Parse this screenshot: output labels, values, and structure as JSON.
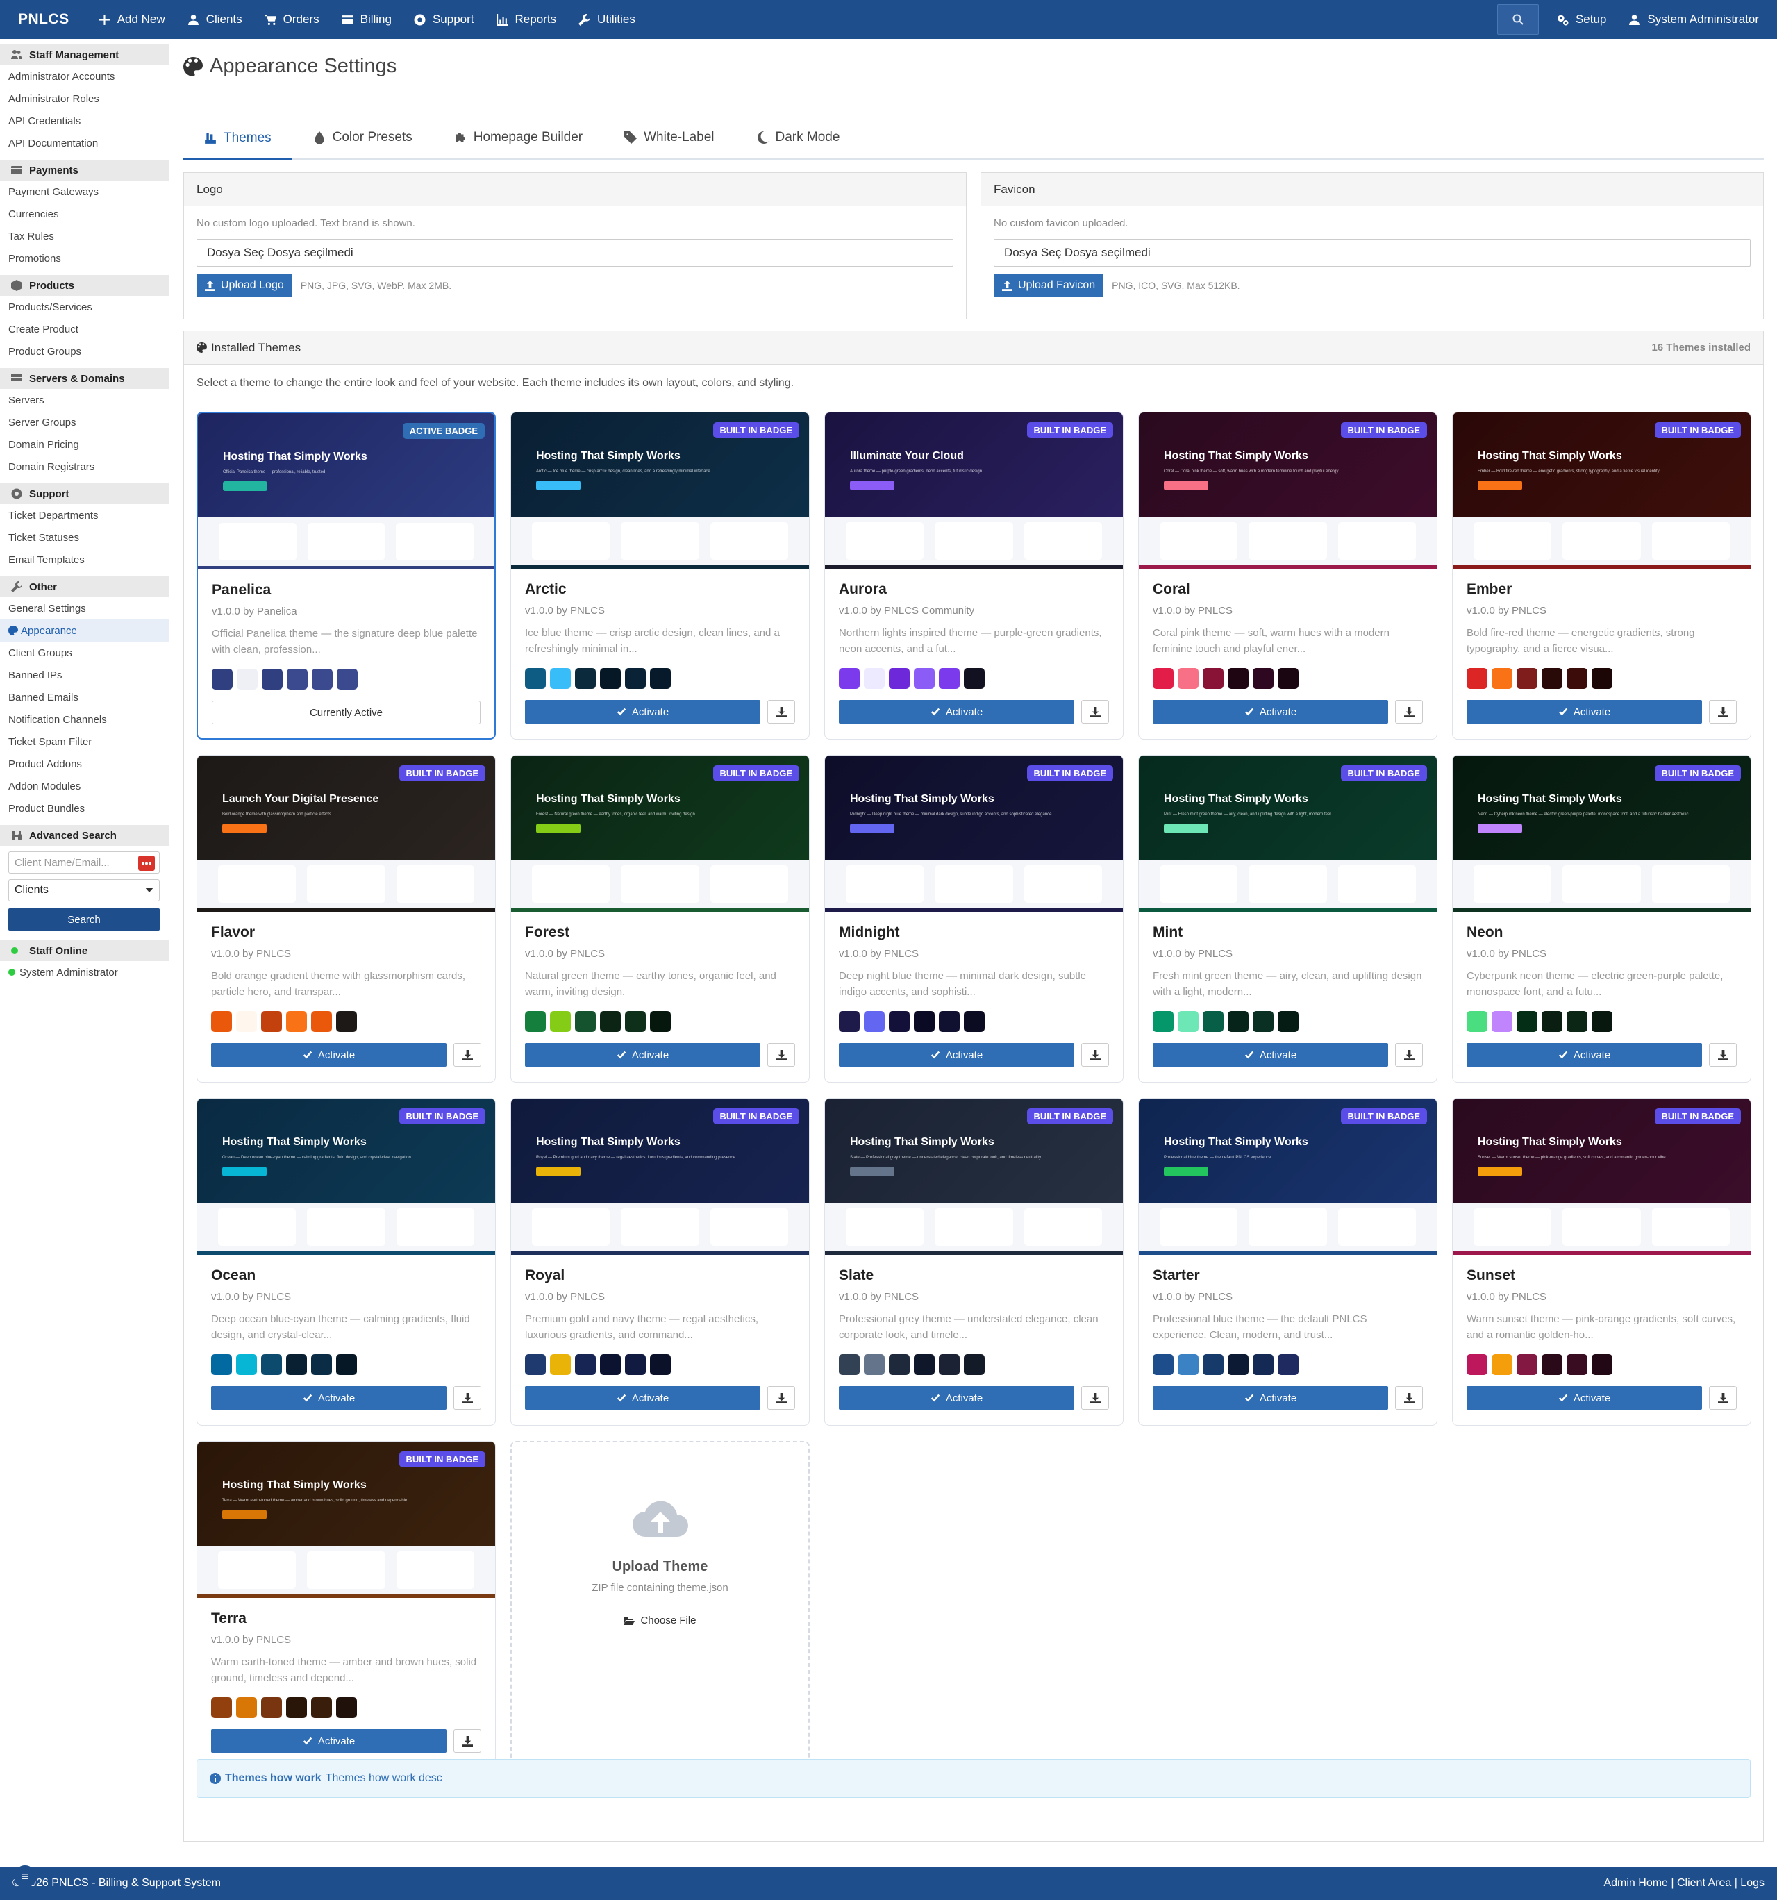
{
  "topbar": {
    "brand": "PNLCS",
    "nav": [
      "Add New",
      "Clients",
      "Orders",
      "Billing",
      "Support",
      "Reports",
      "Utilities"
    ],
    "setup": "Setup",
    "user": "System Administrator"
  },
  "sidebar": {
    "sections": [
      {
        "title": "Staff Management",
        "items": [
          "Administrator Accounts",
          "Administrator Roles",
          "API Credentials",
          "API Documentation"
        ]
      },
      {
        "title": "Payments",
        "items": [
          "Payment Gateways",
          "Currencies",
          "Tax Rules",
          "Promotions"
        ]
      },
      {
        "title": "Products",
        "items": [
          "Products/Services",
          "Create Product",
          "Product Groups"
        ]
      },
      {
        "title": "Servers & Domains",
        "items": [
          "Servers",
          "Server Groups",
          "Domain Pricing",
          "Domain Registrars"
        ]
      },
      {
        "title": "Support",
        "items": [
          "Ticket Departments",
          "Ticket Statuses",
          "Email Templates"
        ]
      },
      {
        "title": "Other",
        "items": [
          "General Settings",
          "Appearance",
          "Client Groups",
          "Banned IPs",
          "Banned Emails",
          "Notification Channels",
          "Ticket Spam Filter",
          "Product Addons",
          "Addon Modules",
          "Product Bundles"
        ]
      }
    ],
    "advanced_search": {
      "title": "Advanced Search",
      "placeholder": "Client Name/Email...",
      "dots": "•••",
      "select_value": "Clients",
      "button": "Search"
    },
    "staff_online": {
      "title": "Staff Online",
      "user": "System Administrator"
    }
  },
  "page": {
    "title": "Appearance Settings",
    "tabs": [
      "Themes",
      "Color Presets",
      "Homepage Builder",
      "White-Label",
      "Dark Mode"
    ]
  },
  "logo_panel": {
    "title": "Logo",
    "note": "No custom logo uploaded. Text brand is shown.",
    "file_text": "Dosya Seç Dosya seçilmedi",
    "button": "Upload Logo",
    "hint": "PNG, JPG, SVG, WebP. Max 2MB."
  },
  "favicon_panel": {
    "title": "Favicon",
    "note": "No custom favicon uploaded.",
    "file_text": "Dosya Seç Dosya seçilmedi",
    "button": "Upload Favicon",
    "hint": "PNG, ICO, SVG. Max 512KB."
  },
  "themes_panel": {
    "title": "Installed Themes",
    "count": "16 Themes installed",
    "intro": "Select a theme to change the entire look and feel of your website. Each theme includes its own layout, colors, and styling.",
    "activate_label": "Activate",
    "current_label": "Currently Active",
    "active_badge": "ACTIVE BADGE",
    "builtin_badge": "BUILT IN BADGE",
    "themes": [
      {
        "name": "Panelica",
        "version": "v1.0.0 by Panelica",
        "desc": "Official Panelica theme — the signature deep blue palette with clean, profession...",
        "preview_title": "Hosting That Simply Works",
        "preview_sub": "Official Panelica theme — professional, reliable, trusted",
        "colors": [
          "#2f3f7f",
          "#eef0f6",
          "#2f3f7f",
          "#3b4a8f",
          "#3b4a8f",
          "#3b4a8f"
        ],
        "grad": [
          "#1e2560",
          "#2c3b80"
        ],
        "btn": "#22b5a0",
        "line": "#2f3f7f",
        "active": true
      },
      {
        "name": "Arctic",
        "version": "v1.0.0 by PNLCS",
        "desc": "Ice blue theme — crisp arctic design, clean lines, and a refreshingly minimal in...",
        "preview_title": "Hosting That Simply Works",
        "preview_sub": "Arctic — Ice blue theme — crisp arctic design, clean lines, and a refreshingly minimal interface.",
        "colors": [
          "#0e5b84",
          "#38bdf8",
          "#0b2a3c",
          "#061826",
          "#0a2236",
          "#071a2b"
        ],
        "grad": [
          "#0a1f33",
          "#0d2f48"
        ],
        "btn": "#38bdf8",
        "line": "#0b2a3c",
        "active": false
      },
      {
        "name": "Aurora",
        "version": "v1.0.0 by PNLCS Community",
        "desc": "Northern lights inspired theme — purple-green gradients, neon accents, and a fut...",
        "preview_title": "Illuminate Your Cloud",
        "preview_sub": "Aurora theme — purple-green gradients, neon accents, futuristic design",
        "colors": [
          "#7c3aed",
          "#ede9fe",
          "#6d28d9",
          "#8b5cf6",
          "#7c3aed",
          "#111122"
        ],
        "grad": [
          "#1a1340",
          "#2a2060"
        ],
        "btn": "#8b5cf6",
        "line": "#1b1b2b",
        "active": false
      },
      {
        "name": "Coral",
        "version": "v1.0.0 by PNLCS",
        "desc": "Coral pink theme — soft, warm hues with a modern feminine touch and playful ener...",
        "preview_title": "Hosting That Simply Works",
        "preview_sub": "Coral — Coral pink theme — soft, warm hues with a modern feminine touch and playful energy.",
        "colors": [
          "#e11d48",
          "#f77085",
          "#881337",
          "#1f0512",
          "#2e0820",
          "#1a0610"
        ],
        "grad": [
          "#2a0a1e",
          "#3d0c2a"
        ],
        "btn": "#f77085",
        "line": "#9c1a4a",
        "active": false
      },
      {
        "name": "Ember",
        "version": "v1.0.0 by PNLCS",
        "desc": "Bold fire-red theme — energetic gradients, strong typography, and a fierce visua...",
        "preview_title": "Hosting That Simply Works",
        "preview_sub": "Ember — Bold fire-red theme — energetic gradients, strong typography, and a fierce visual identity.",
        "colors": [
          "#dc2626",
          "#f97316",
          "#7f1d1d",
          "#2a0a08",
          "#3b0c0a",
          "#1c0606"
        ],
        "grad": [
          "#2a0808",
          "#3d0f0a"
        ],
        "btn": "#f97316",
        "line": "#8b1a1a",
        "active": false
      },
      {
        "name": "Flavor",
        "version": "v1.0.0 by PNLCS",
        "desc": "Bold orange gradient theme with glassmorphism cards, particle hero, and transpar...",
        "preview_title": "Launch Your Digital Presence",
        "preview_sub": "Bold orange theme with glassmorphism and particle effects",
        "colors": [
          "#ea580c",
          "#fff7ed",
          "#c2410c",
          "#f97316",
          "#ea580c",
          "#1c1917"
        ],
        "grad": [
          "#1c1917",
          "#2b2420"
        ],
        "btn": "#f97316",
        "line": "#1c1917",
        "active": false
      },
      {
        "name": "Forest",
        "version": "v1.0.0 by PNLCS",
        "desc": "Natural green theme — earthy tones, organic feel, and warm, inviting design.",
        "preview_title": "Hosting That Simply Works",
        "preview_sub": "Forest — Natural green theme — earthy tones, organic feel, and warm, inviting design.",
        "colors": [
          "#15803d",
          "#84cc16",
          "#14532d",
          "#0b2414",
          "#0e2f1a",
          "#06180d"
        ],
        "grad": [
          "#0b2414",
          "#0f3a1c"
        ],
        "btn": "#84cc16",
        "line": "#1a5c32",
        "active": false
      },
      {
        "name": "Midnight",
        "version": "v1.0.0 by PNLCS",
        "desc": "Deep night blue theme — minimal dark design, subtle indigo accents, and sophisti...",
        "preview_title": "Hosting That Simply Works",
        "preview_sub": "Midnight — Deep night blue theme — minimal dark design, subtle indigo accents, and sophisticated elegance.",
        "colors": [
          "#1e1b4b",
          "#6366f1",
          "#13113a",
          "#0a0a24",
          "#101030",
          "#0b0b22"
        ],
        "grad": [
          "#0e0e2a",
          "#16163c"
        ],
        "btn": "#6366f1",
        "line": "#1e1b4b",
        "active": false
      },
      {
        "name": "Mint",
        "version": "v1.0.0 by PNLCS",
        "desc": "Fresh mint green theme — airy, clean, and uplifting design with a light, modern...",
        "preview_title": "Hosting That Simply Works",
        "preview_sub": "Mint — Fresh mint green theme — airy, clean, and uplifting design with a light, modern feel.",
        "colors": [
          "#059669",
          "#6ee7b7",
          "#065f46",
          "#06241a",
          "#093023",
          "#051c14"
        ],
        "grad": [
          "#062a1e",
          "#0a3b2a"
        ],
        "btn": "#6ee7b7",
        "line": "#0b5a40",
        "active": false
      },
      {
        "name": "Neon",
        "version": "v1.0.0 by PNLCS",
        "desc": "Cyberpunk neon theme — electric green-purple palette, monospace font, and a futu...",
        "preview_title": "Hosting That Simply Works",
        "preview_sub": "Neon — Cyberpunk neon theme — electric green-purple palette, monospace font, and a futuristic hacker aesthetic.",
        "colors": [
          "#4ade80",
          "#c084fc",
          "#052e16",
          "#0a1f12",
          "#0c2616",
          "#08180e"
        ],
        "grad": [
          "#06180e",
          "#0a2416"
        ],
        "btn": "#c084fc",
        "line": "#0d3320",
        "active": false
      },
      {
        "name": "Ocean",
        "version": "v1.0.0 by PNLCS",
        "desc": "Deep ocean blue-cyan theme — calming gradients, fluid design, and crystal-clear...",
        "preview_title": "Hosting That Simply Works",
        "preview_sub": "Ocean — Deep ocean blue-cyan theme — calming gradients, fluid design, and crystal-clear navigation.",
        "colors": [
          "#0369a1",
          "#06b6d4",
          "#0c4a6e",
          "#082032",
          "#0b2c45",
          "#061826"
        ],
        "grad": [
          "#0a2a42",
          "#0d3a55"
        ],
        "btn": "#06b6d4",
        "line": "#0c4a6e",
        "active": false
      },
      {
        "name": "Royal",
        "version": "v1.0.0 by PNLCS",
        "desc": "Premium gold and navy theme — regal aesthetics, luxurious gradients, and command...",
        "preview_title": "Hosting That Simply Works",
        "preview_sub": "Royal — Premium gold and navy theme — regal aesthetics, luxurious gradients, and commanding presence.",
        "colors": [
          "#1e3a6e",
          "#eab308",
          "#172554",
          "#0b1330",
          "#111a40",
          "#0a1128"
        ],
        "grad": [
          "#0f1a3c",
          "#17234f"
        ],
        "btn": "#eab308",
        "line": "#1e2f5c",
        "active": false
      },
      {
        "name": "Slate",
        "version": "v1.0.0 by PNLCS",
        "desc": "Professional grey theme — understated elegance, clean corporate look, and timele...",
        "preview_title": "Hosting That Simply Works",
        "preview_sub": "Slate — Professional grey theme — understated elegance, clean corporate look, and timeless neutrality.",
        "colors": [
          "#334155",
          "#64748b",
          "#1e293b",
          "#0f172a",
          "#1a2233",
          "#141b28"
        ],
        "grad": [
          "#1a2233",
          "#263040"
        ],
        "btn": "#64748b",
        "line": "#1e293b",
        "active": false
      },
      {
        "name": "Starter",
        "version": "v1.0.0 by PNLCS",
        "desc": "Professional blue theme — the default PNLCS experience. Clean, modern, and trust...",
        "preview_title": "Hosting That Simply Works",
        "preview_sub": "Professional blue theme — the default PNLCS experience",
        "colors": [
          "#1e4d8c",
          "#3b82c4",
          "#163a6a",
          "#0c1a33",
          "#142a55",
          "#1e2a60"
        ],
        "grad": [
          "#0f2550",
          "#1a3570"
        ],
        "btn": "#22c55e",
        "line": "#1e4d8c",
        "active": false
      },
      {
        "name": "Sunset",
        "version": "v1.0.0 by PNLCS",
        "desc": "Warm sunset theme — pink-orange gradients, soft curves, and a romantic golden-ho...",
        "preview_title": "Hosting That Simply Works",
        "preview_sub": "Sunset — Warm sunset theme — pink-orange gradients, soft curves, and a romantic golden-hour vibe.",
        "colors": [
          "#be185d",
          "#f59e0b",
          "#831843",
          "#2a0a18",
          "#3a0c22",
          "#220814"
        ],
        "grad": [
          "#2a0a1e",
          "#3b0d2a"
        ],
        "btn": "#f59e0b",
        "line": "#9d174d",
        "active": false
      },
      {
        "name": "Terra",
        "version": "v1.0.0 by PNLCS",
        "desc": "Warm earth-toned theme — amber and brown hues, solid ground, timeless and depend...",
        "preview_title": "Hosting That Simply Works",
        "preview_sub": "Terra — Warm earth-toned theme — amber and brown hues, solid ground, timeless and dependable.",
        "colors": [
          "#92400e",
          "#d97706",
          "#78350f",
          "#2a1608",
          "#3a1e0c",
          "#20110a"
        ],
        "grad": [
          "#2a1608",
          "#3b220e"
        ],
        "btn": "#d97706",
        "line": "#7a3a12",
        "active": false
      }
    ],
    "upload": {
      "title": "Upload Theme",
      "sub": "ZIP file containing theme.json",
      "button": "Choose File"
    }
  },
  "info": {
    "title": "Themes how work",
    "text": "Themes how work desc"
  },
  "footer": {
    "copyright": "© 2026 PNLCS - Billing & Support System",
    "links": "Admin Home | Client Area | Logs"
  },
  "float_icon": "menu-icon"
}
